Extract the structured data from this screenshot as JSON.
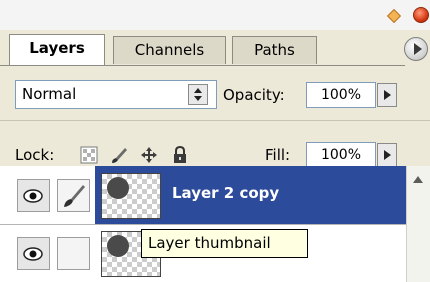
{
  "tabs": [
    {
      "label": "Layers",
      "active": true
    },
    {
      "label": "Channels",
      "active": false
    },
    {
      "label": "Paths",
      "active": false
    }
  ],
  "blend_mode": {
    "value": "Normal"
  },
  "opacity": {
    "label": "Opacity:",
    "value": "100%"
  },
  "lock": {
    "label": "Lock:"
  },
  "fill": {
    "label": "Fill:",
    "value": "100%"
  },
  "layers": [
    {
      "name": "Layer 2 copy",
      "selected": true,
      "visible": true
    },
    {
      "name": "",
      "selected": false,
      "visible": true
    }
  ],
  "tooltip": {
    "text": "Layer thumbnail"
  },
  "colors": {
    "selection": "#2c4b9b",
    "tooltip_bg": "#ffffe1",
    "panel_bg": "#ece9d8"
  }
}
